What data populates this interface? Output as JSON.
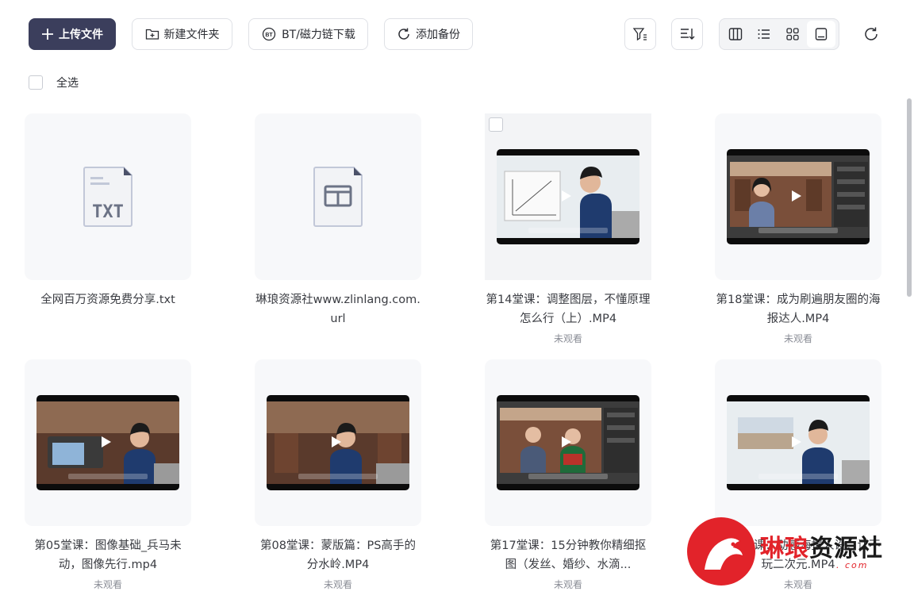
{
  "toolbar": {
    "upload_label": "上传文件",
    "new_folder_label": "新建文件夹",
    "bt_label": "BT/磁力链下载",
    "backup_label": "添加备份"
  },
  "select_all_label": "全选",
  "files": [
    {
      "name": "全网百万资源免费分享.txt",
      "type": "txt",
      "status": "",
      "icon_text": "TXT"
    },
    {
      "name": "琳琅资源社www.zlinlang.com.url",
      "type": "url",
      "status": ""
    },
    {
      "name": "第14堂课：调整图层，不懂原理怎么行（上）.MP4",
      "type": "video",
      "status": "未观看"
    },
    {
      "name": "第18堂课：成为刷遍朋友圈的海报达人.MP4",
      "type": "video",
      "status": "未观看"
    },
    {
      "name": "第05堂课：图像基础_兵马未动，图像先行.mp4",
      "type": "video",
      "status": "未观看"
    },
    {
      "name": "第08堂课：蒙版篇：PS高手的分水岭.MP4",
      "type": "video",
      "status": "未观看"
    },
    {
      "name": "第17堂课：15分钟教你精细抠图（发丝、婚纱、水滴...",
      "type": "video",
      "status": "未观看"
    },
    {
      "name": "第16堂课：动感海报人设：让不玩二次元.MP4",
      "type": "video",
      "status": "未观看"
    }
  ],
  "watermark": {
    "text_red": "琳琅",
    "text_black": "资源社",
    "domain": ". com"
  },
  "colors": {
    "primary": "#3b3e5c",
    "card_bg": "#f7f8fa",
    "muted": "#8a8d96"
  }
}
